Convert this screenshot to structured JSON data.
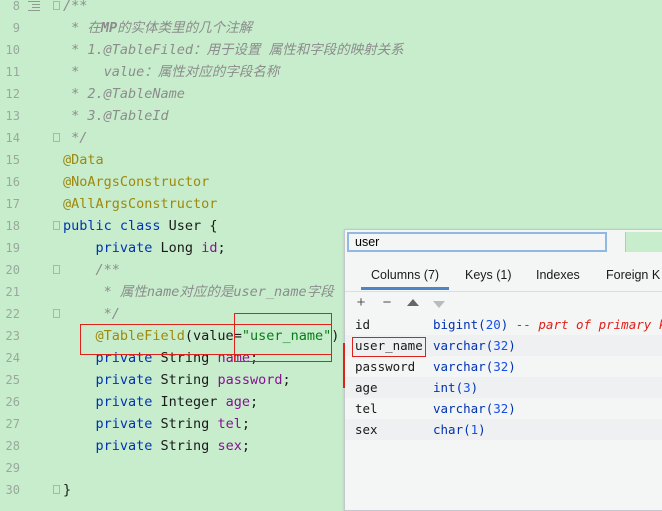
{
  "editor": {
    "line_numbers": [
      "8",
      "9",
      "10",
      "11",
      "12",
      "13",
      "14",
      "15",
      "16",
      "17",
      "18",
      "19",
      "20",
      "21",
      "22",
      "23",
      "24",
      "25",
      "26",
      "27",
      "28",
      "29",
      "30"
    ],
    "l8": "/**",
    "l9a": " * 在",
    "l9b": "MP",
    "l9c": "的实体类里的几个注解",
    "l10a": " * 1.",
    "l10b": "@TableFiled",
    "l10c": "：用于设置 属性和字段的映射关系",
    "l11a": " *   ",
    "l11b": "value",
    "l11c": "：属性对应的字段名称",
    "l12a": " * 2.",
    "l12b": "@TableName",
    "l13a": " * 3.",
    "l13b": "@TableId",
    "l14": " */",
    "l15": "@Data",
    "l16": "@NoArgsConstructor",
    "l17": "@AllArgsConstructor",
    "l18a": "public class",
    "l18b": " User {",
    "l19a": "    private",
    "l19b": " Long ",
    "l19c": "id",
    "l19d": ";",
    "l20": "    /**",
    "l21a": "     * 属性",
    "l21b": "name",
    "l21c": "对应的是",
    "l21d": "user_name",
    "l21e": "字段",
    "l22": "     */",
    "l23a": "    @TableField",
    "l23b": "(value=",
    "l23c": "\"user_name\"",
    "l23d": ")",
    "l24a": "    private",
    "l24b": " String ",
    "l24c": "name",
    "l24d": ";",
    "l25a": "    private",
    "l25b": " String ",
    "l25c": "password",
    "l25d": ";",
    "l26a": "    private",
    "l26b": " Integer ",
    "l26c": "age",
    "l26d": ";",
    "l27a": "    private",
    "l27b": " String ",
    "l27c": "tel",
    "l27d": ";",
    "l28a": "    private",
    "l28b": " String ",
    "l28c": "sex",
    "l28d": ";",
    "l30": "}"
  },
  "popup": {
    "search_value": "user",
    "tabs": [
      "Columns (7)",
      "Keys (1)",
      "Indexes",
      "Foreign K"
    ],
    "toolbar": [
      "+",
      "−",
      "up-arrow-icon",
      "down-arrow-icon"
    ],
    "rows": [
      {
        "name": "id",
        "type": "bigint",
        "size": "20",
        "comment": "-- part of primary key"
      },
      {
        "name": "user_name",
        "type": "varchar",
        "size": "32",
        "comment": ""
      },
      {
        "name": "password",
        "type": "varchar",
        "size": "32",
        "comment": ""
      },
      {
        "name": "age",
        "type": "int",
        "size": "3",
        "comment": ""
      },
      {
        "name": "tel",
        "type": "varchar",
        "size": "32",
        "comment": ""
      },
      {
        "name": "sex",
        "type": "char",
        "size": "1",
        "comment": ""
      }
    ]
  },
  "colors": {
    "background": "#c7edcc",
    "keyword": "#0033b3",
    "annotation": "#9e880d",
    "field": "#871094",
    "string": "#067d17",
    "highlight": "#e0201b"
  }
}
